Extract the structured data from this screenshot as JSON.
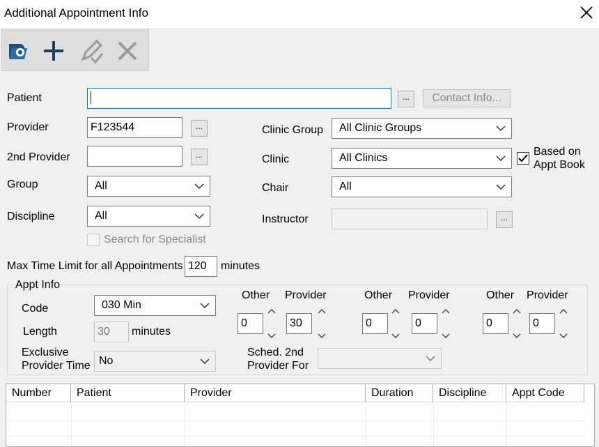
{
  "window": {
    "title": "Additional Appointment Info"
  },
  "toolbar": {
    "icons": [
      "open-icon",
      "add-icon",
      "edit-icon",
      "delete-icon"
    ]
  },
  "patient": {
    "label": "Patient",
    "value": "",
    "contact_label": "Contact Info..."
  },
  "provider": {
    "label": "Provider",
    "value": "F123544"
  },
  "provider2": {
    "label": "2nd Provider",
    "value": ""
  },
  "group": {
    "label": "Group",
    "value": "All"
  },
  "discipline": {
    "label": "Discipline",
    "value": "All"
  },
  "specialist": {
    "label": "Search for Specialist",
    "checked": false
  },
  "clinic_group": {
    "label": "Clinic Group",
    "value": "All Clinic Groups"
  },
  "clinic": {
    "label": "Clinic",
    "value": "All Clinics"
  },
  "based_on": {
    "label1": "Based on",
    "label2": "Appt Book",
    "checked": true
  },
  "chair": {
    "label": "Chair",
    "value": "All"
  },
  "instructor": {
    "label": "Instructor",
    "value": ""
  },
  "max_time": {
    "label": "Max Time Limit for all Appointments",
    "value": "120",
    "unit": "minutes"
  },
  "appt_info": {
    "legend": "Appt Info",
    "code_label": "Code",
    "code_value": "030 Min",
    "length_label": "Length",
    "length_value": "30",
    "length_unit": "minutes",
    "exclusive_label1": "Exclusive",
    "exclusive_label2": "Provider Time",
    "exclusive_value": "No",
    "sched_label1": "Sched. 2nd",
    "sched_label2": "Provider For",
    "sched_value": "",
    "slots": [
      {
        "other_label": "Other",
        "other_value": "0",
        "provider_label": "Provider",
        "provider_value": "30"
      },
      {
        "other_label": "Other",
        "other_value": "0",
        "provider_label": "Provider",
        "provider_value": "0"
      },
      {
        "other_label": "Other",
        "other_value": "0",
        "provider_label": "Provider",
        "provider_value": "0"
      }
    ]
  },
  "grid": {
    "columns": [
      "Number",
      "Patient",
      "Provider",
      "Duration",
      "Discipline",
      "Appt Code"
    ]
  },
  "colors": {
    "focus_border": "#0078d7",
    "window_bg": "#f0f0f0"
  }
}
